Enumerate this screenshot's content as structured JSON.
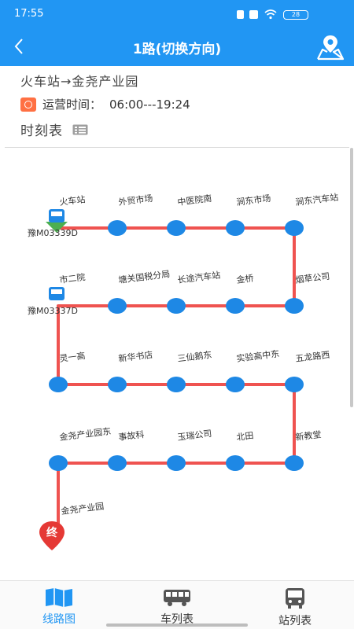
{
  "status_bar": {
    "time": "17:55",
    "battery": "28"
  },
  "header": {
    "title": "1路(切换方向)"
  },
  "route_info": {
    "name": "火车站→金尧产业园",
    "optime_label": "运营时间：",
    "optime_value": "06:00---19:24"
  },
  "timetable": {
    "label": "时刻表"
  },
  "stops": [
    "火车站",
    "外贸市场",
    "中医院南",
    "涧东市场",
    "涧东汽车站",
    "烟草公司",
    "金桥",
    "长途汽车站",
    "塘关国税分局",
    "市二院",
    "灵一高",
    "新华书店",
    "三仙鹅东",
    "实验高中东",
    "五龙路西",
    "新教堂",
    "北田",
    "玉瑞公司",
    "事故科",
    "金尧产业园东",
    "金尧产业园"
  ],
  "buses": [
    {
      "plate": "豫M03339D",
      "at_stop": 0
    },
    {
      "plate": "豫M03337D",
      "at_stop": 9
    }
  ],
  "end_marker": {
    "label": "终"
  },
  "bottom_nav": {
    "tabs": [
      {
        "label": "线路图",
        "active": true,
        "icon": "map-book-icon"
      },
      {
        "label": "车列表",
        "active": false,
        "icon": "bus-side-icon"
      },
      {
        "label": "站列表",
        "active": false,
        "icon": "bus-front-icon"
      }
    ]
  },
  "colors": {
    "primary": "#2196f3",
    "route_line": "#ef5350",
    "stop": "#1e88e5",
    "end_marker": "#e53935",
    "bus_green": "#4caf50"
  }
}
